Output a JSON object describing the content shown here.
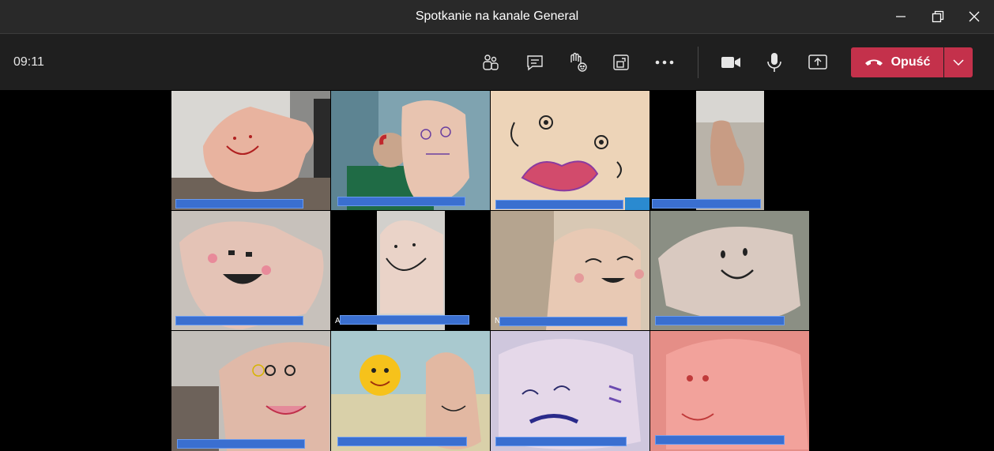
{
  "window": {
    "title": "Spotkanie na kanale General"
  },
  "toolbar": {
    "timer": "09:11",
    "buttons": [
      {
        "icon": "participants-icon"
      },
      {
        "icon": "chat-icon"
      },
      {
        "icon": "raise-hand-icon"
      },
      {
        "icon": "breakout-rooms-icon"
      },
      {
        "icon": "more-options-icon"
      },
      {
        "icon": "camera-icon"
      },
      {
        "icon": "microphone-icon"
      },
      {
        "icon": "share-screen-icon"
      }
    ],
    "leave_label": "Opuść",
    "leave_color": "#c4314b"
  },
  "participant_labels": [
    "",
    "",
    "",
    "",
    "",
    "A",
    "N",
    "",
    "",
    "",
    "",
    ""
  ]
}
